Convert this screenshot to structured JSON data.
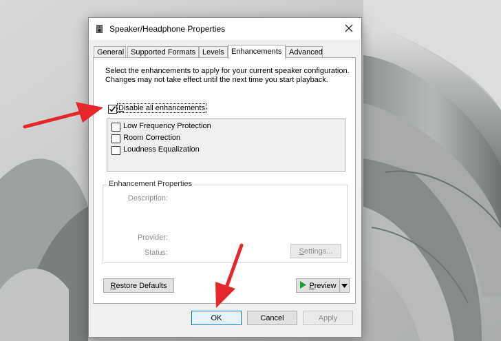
{
  "window": {
    "title": "Speaker/Headphone Properties",
    "icon": "speaker-icon",
    "close_icon": "close-icon"
  },
  "tabs": [
    {
      "label": "General",
      "active": false
    },
    {
      "label": "Supported Formats",
      "active": false
    },
    {
      "label": "Levels",
      "active": false
    },
    {
      "label": "Enhancements",
      "active": true
    },
    {
      "label": "Advanced",
      "active": false
    }
  ],
  "enhancements": {
    "intro_text": "Select the enhancements to apply for your current speaker configuration. Changes may not take effect until the next time you start playback.",
    "disable_all": {
      "label": "Disable all enhancements",
      "checked": true
    },
    "items": [
      {
        "label": "Low Frequency Protection",
        "checked": false
      },
      {
        "label": "Room Correction",
        "checked": false
      },
      {
        "label": "Loudness Equalization",
        "checked": false
      }
    ]
  },
  "properties": {
    "title": "Enhancement Properties",
    "description_label": "Description:",
    "provider_label": "Provider:",
    "status_label": "Status:",
    "settings_button": "Settings..."
  },
  "buttons": {
    "restore_defaults": "Restore Defaults",
    "preview": "Preview",
    "ok": "OK",
    "cancel": "Cancel",
    "apply": "Apply"
  },
  "colors": {
    "annotation_arrow": "#e5262b",
    "focus_blue": "#0078d7",
    "preview_play": "#1f9b3a"
  }
}
